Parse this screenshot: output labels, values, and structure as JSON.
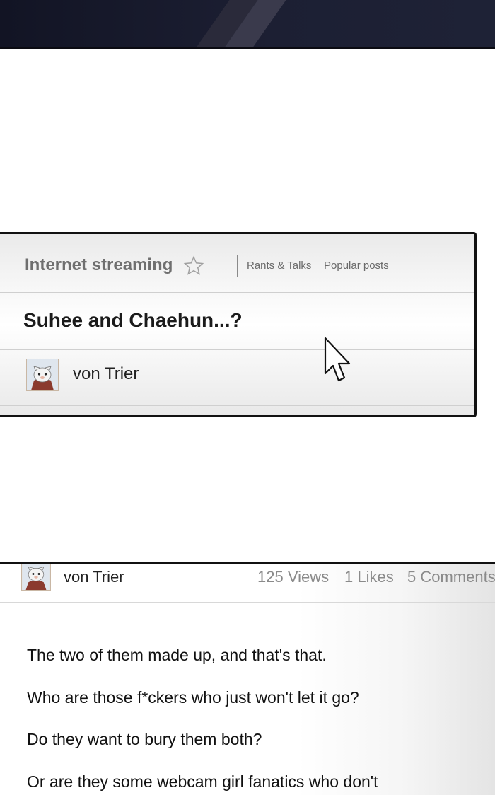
{
  "forum_card": {
    "board_name": "Internet streaming",
    "nav": [
      "Rants & Talks",
      "Popular posts"
    ],
    "post_title": "Suhee and Chaehun...?",
    "author": "von Trier"
  },
  "post_detail": {
    "author": "von Trier",
    "stats": {
      "views": "125 Views",
      "likes": "1 Likes",
      "comments": "5 Comments"
    },
    "body": [
      "The two of them made up, and that's that.",
      "Who are those f*ckers who just won't let it go?",
      "Do they want to bury them both?",
      "Or are they some webcam girl fanatics who don't"
    ]
  },
  "icons": [
    "star-icon",
    "cursor-icon",
    "cat-avatar"
  ],
  "colors": {
    "frame": "#111111",
    "muted_text": "#6f6f6f",
    "top_band": "#1c1f33"
  }
}
